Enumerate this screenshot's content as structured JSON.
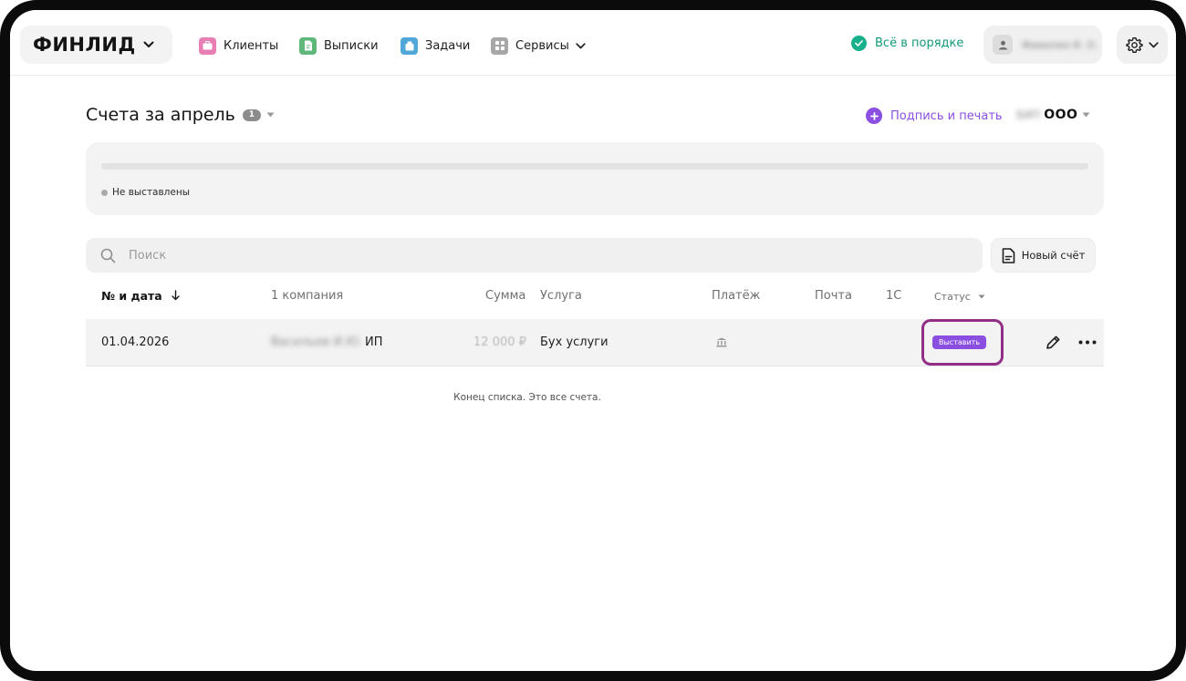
{
  "brand": {
    "logo_text": "ФИНЛИД"
  },
  "nav": {
    "items": [
      {
        "label": "Клиенты",
        "color": "#e87fb4"
      },
      {
        "label": "Выписки",
        "color": "#5fb77a"
      },
      {
        "label": "Задачи",
        "color": "#4fa8d8"
      },
      {
        "label": "Сервисы",
        "color": "#a7a7a7"
      }
    ]
  },
  "header": {
    "status_text": "Всё в порядке",
    "user_name": "Фамилия И. О."
  },
  "page": {
    "title": "Счета за апрель",
    "count": "1",
    "sign_print_label": "Подпись и печать",
    "org_prefix": "БИП",
    "org_name": "ООО"
  },
  "summary": {
    "legend_label": "Не выставлены"
  },
  "search": {
    "placeholder": "Поиск"
  },
  "actions": {
    "new_invoice_label": "Новый счёт"
  },
  "table": {
    "headers": {
      "number_date": "№ и дата",
      "company": "1 компания",
      "amount": "Сумма",
      "service": "Услуга",
      "payment": "Платёж",
      "mail": "Почта",
      "onec": "1С",
      "status": "Статус"
    },
    "rows": [
      {
        "date": "01.04.2026",
        "client_name": "Васильев И.Ю.",
        "client_type": "ИП",
        "amount": "12 000 ₽",
        "service": "Бух услуги",
        "status_action": "Выставить"
      }
    ]
  },
  "footer": {
    "end_note": "Конец списка. Это все счета."
  },
  "colors": {
    "accent": "#8a4fe0",
    "ok_green": "#17b08a",
    "highlight": "#932e86"
  }
}
